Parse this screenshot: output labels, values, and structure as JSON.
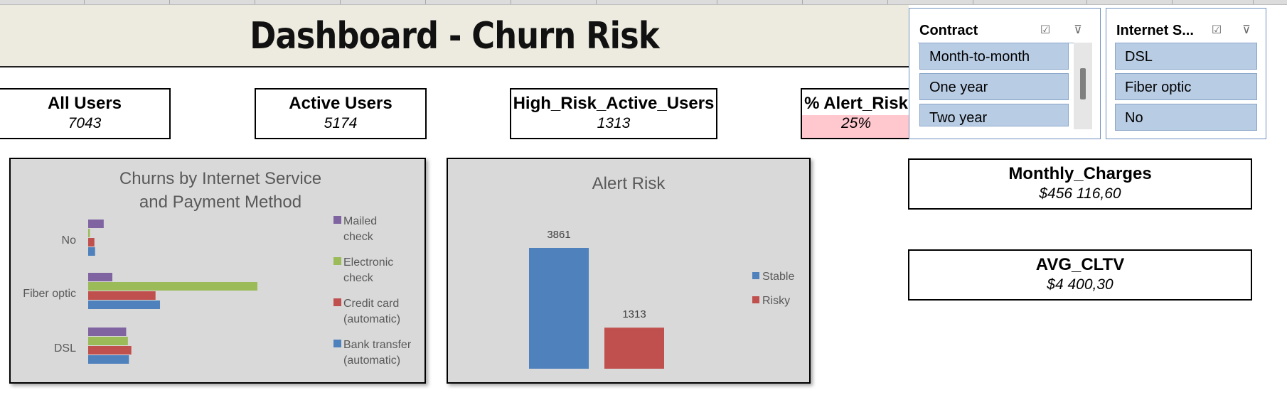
{
  "title": "Dashboard - Churn Risk",
  "kpis": {
    "all_users": {
      "label": "All Users",
      "value": "7043"
    },
    "active_users": {
      "label": "Active Users",
      "value": "5174"
    },
    "high_risk": {
      "label": "High_Risk_Active_Users",
      "value": "1313"
    },
    "alert_risk": {
      "label": "% Alert_Risk",
      "value": "25%"
    },
    "monthly_charges": {
      "label": "Monthly_Charges",
      "value": "$456 116,60"
    },
    "avg_cltv": {
      "label": "AVG_CLTV",
      "value": "$4 400,30"
    }
  },
  "slicers": {
    "contract": {
      "name": "Contract",
      "items": [
        "Month-to-month",
        "One year",
        "Two year"
      ]
    },
    "internet": {
      "name": "Internet S...",
      "items": [
        "DSL",
        "Fiber optic",
        "No"
      ]
    },
    "icons": {
      "multi_select": "multi-select-icon",
      "clear_filter": "clear-filter-icon"
    }
  },
  "colors": {
    "bank_transfer": "#4f81bd",
    "credit_card": "#c0504d",
    "electronic_check": "#9bbb59",
    "mailed_check": "#8064a2",
    "slicer_item": "#b8cce4",
    "alert_bg": "#ffc7ce",
    "chart_bg": "#d9d9d9"
  },
  "chart_data": [
    {
      "type": "bar",
      "orientation": "horizontal",
      "title": "Churns by Internet Service and Payment Method",
      "categories": [
        "No",
        "Fiber optic",
        "DSL"
      ],
      "series": [
        {
          "name": "Mailed check",
          "values": [
            45,
            70,
            110
          ]
        },
        {
          "name": "Electronic check",
          "values": [
            5,
            490,
            115
          ]
        },
        {
          "name": "Credit card (automatic)",
          "values": [
            18,
            195,
            125
          ]
        },
        {
          "name": "Bank transfer (automatic)",
          "values": [
            20,
            208,
            118
          ]
        }
      ],
      "legend": "right",
      "grid": false
    },
    {
      "type": "bar",
      "title": "Alert Risk",
      "categories": [
        "Stable",
        "Risky"
      ],
      "series": [
        {
          "name": "Stable",
          "values": [
            3861,
            null
          ]
        },
        {
          "name": "Risky",
          "values": [
            null,
            1313
          ]
        }
      ],
      "data_labels": [
        "3861",
        "1313"
      ],
      "legend": "right",
      "grid": false
    }
  ]
}
